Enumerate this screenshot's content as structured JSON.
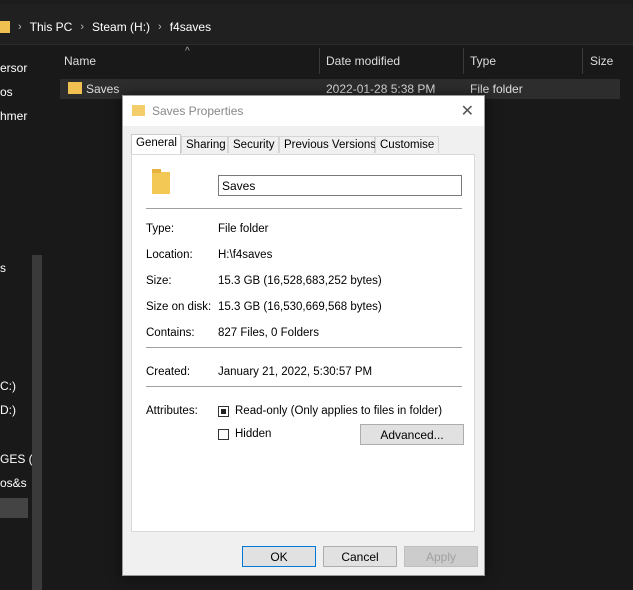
{
  "explorer": {
    "breadcrumb": [
      "This PC",
      "Steam (H:)",
      "f4saves"
    ],
    "sidebar_fragments": [
      "ersor",
      "os",
      "hmer",
      "s",
      "C:)",
      "D:)",
      "GES (F",
      "os&s"
    ],
    "columns": [
      "Name",
      "Date modified",
      "Type",
      "Size"
    ],
    "rows": [
      {
        "name": "Saves",
        "date": "2022-01-28 5:38 PM",
        "type": "File folder"
      }
    ]
  },
  "dialog": {
    "title": "Saves Properties",
    "close_glyph": "✕",
    "tabs": [
      "General",
      "Sharing",
      "Security",
      "Previous Versions",
      "Customise"
    ],
    "active_tab": "General",
    "name_value": "Saves",
    "fields": {
      "type_label": "Type:",
      "type_value": "File folder",
      "location_label": "Location:",
      "location_value": "H:\\f4saves",
      "size_label": "Size:",
      "size_value": "15.3 GB (16,528,683,252 bytes)",
      "size_on_disk_label": "Size on disk:",
      "size_on_disk_value": "15.3 GB (16,530,669,568 bytes)",
      "contains_label": "Contains:",
      "contains_value": "827 Files, 0 Folders",
      "created_label": "Created:",
      "created_value": "January 21, 2022, 5:30:57 PM",
      "attributes_label": "Attributes:"
    },
    "readonly_label": "Read-only (Only applies to files in folder)",
    "hidden_label": "Hidden",
    "advanced_label": "Advanced...",
    "ok_label": "OK",
    "cancel_label": "Cancel",
    "apply_label": "Apply"
  },
  "colors": {
    "folder": "#f3c854",
    "accent": "#0078d7"
  }
}
